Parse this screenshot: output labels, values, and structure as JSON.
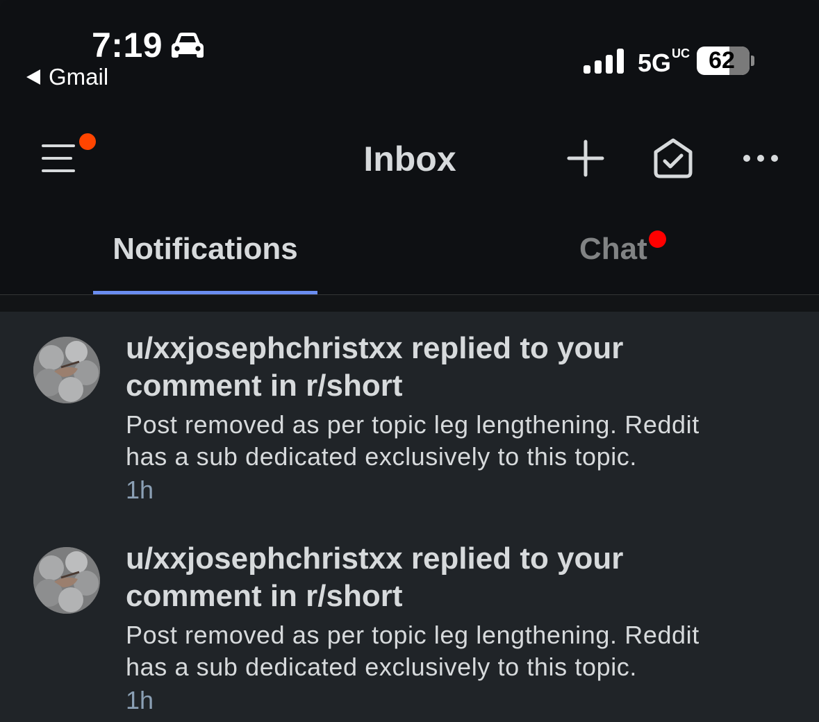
{
  "status_bar": {
    "time": "7:19",
    "back_app": "Gmail",
    "network": "5G",
    "network_suffix": "UC",
    "battery_percent": 62,
    "battery_label": "62",
    "icons": [
      "car-icon",
      "signal-icon",
      "battery-icon"
    ]
  },
  "header": {
    "title": "Inbox",
    "menu_has_badge": true,
    "actions": [
      "menu-icon",
      "plus-icon",
      "mark-read-icon",
      "more-icon"
    ],
    "badge_color": "#ff4500"
  },
  "tabs": [
    {
      "label": "Notifications",
      "active": true
    },
    {
      "label": "Chat",
      "active": false,
      "has_dot": true
    }
  ],
  "accent_color": "#6a8df0",
  "notifications": [
    {
      "title_line1": "u/xxjosephchristxx replied to your",
      "title_line2": "comment in r/short",
      "body_line1": "Post removed as per topic leg lengthening.  Reddit",
      "body_line2": "has a sub dedicated exclusively to this topic.",
      "time": "1h"
    },
    {
      "title_line1": "u/xxjosephchristxx replied to your",
      "title_line2": "comment in r/short",
      "body_line1": "Post removed as per topic leg lengthening.  Reddit",
      "body_line2": "has a sub dedicated exclusively to this topic.",
      "time": "1h"
    }
  ]
}
